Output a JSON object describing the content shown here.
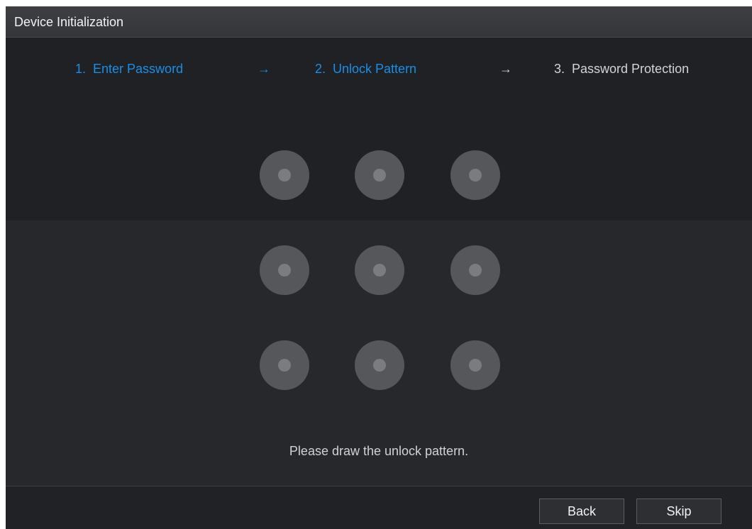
{
  "window": {
    "title": "Device Initialization"
  },
  "steps": [
    {
      "label": "1.  Enter Password",
      "state": "done"
    },
    {
      "label": "2.  Unlock Pattern",
      "state": "current"
    },
    {
      "label": "3.  Password Protection",
      "state": "pending"
    }
  ],
  "arrows": {
    "first": "→",
    "second": "→"
  },
  "pattern": {
    "rows": 3,
    "cols": 3,
    "hint": "Please draw the unlock pattern."
  },
  "buttons": {
    "back_label": "Back",
    "skip_label": "Skip"
  },
  "colors": {
    "accent": "#1a8ee6",
    "background": "#1f2125",
    "titlebar": "#3a3c40"
  }
}
